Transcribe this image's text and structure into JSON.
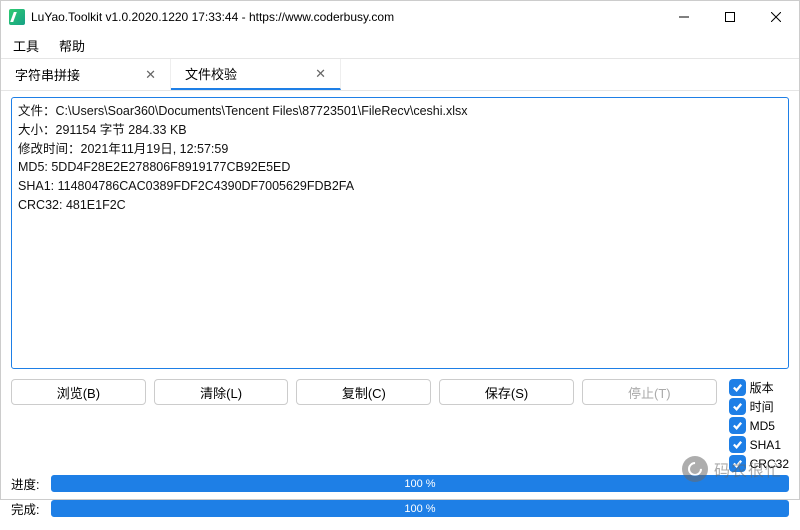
{
  "window": {
    "title": "LuYao.Toolkit v1.0.2020.1220 17:33:44 - https://www.coderbusy.com"
  },
  "menu": {
    "tools": "工具",
    "help": "帮助"
  },
  "tabs": [
    {
      "label": "字符串拼接",
      "active": false
    },
    {
      "label": "文件校验",
      "active": true
    }
  ],
  "result": {
    "file_label": "文件：",
    "file_path": "C:\\Users\\Soar360\\Documents\\Tencent Files\\87723501\\FileRecv\\ceshi.xlsx",
    "size_label": "大小：",
    "size_value": "291154 字节 284.33 KB",
    "mtime_label": "修改时间：",
    "mtime_value": "2021年11月19日, 12:57:59",
    "md5_label": "MD5: ",
    "md5_value": "5DD4F28E2E278806F8919177CB92E5ED",
    "sha1_label": "SHA1: ",
    "sha1_value": "114804786CAC0389FDF2C4390DF7005629FDB2FA",
    "crc32_label": "CRC32: ",
    "crc32_value": "481E1F2C"
  },
  "buttons": {
    "browse": "浏览(B)",
    "clear": "清除(L)",
    "copy": "复制(C)",
    "save": "保存(S)",
    "stop": "停止(T)"
  },
  "checks": {
    "version": "版本",
    "time": "时间",
    "md5": "MD5",
    "sha1": "SHA1",
    "crc32": "CRC32"
  },
  "progress": {
    "label1": "进度:",
    "value1": "100 %",
    "label2": "完成:",
    "value2": "100 %"
  },
  "watermark": "码农很忙"
}
